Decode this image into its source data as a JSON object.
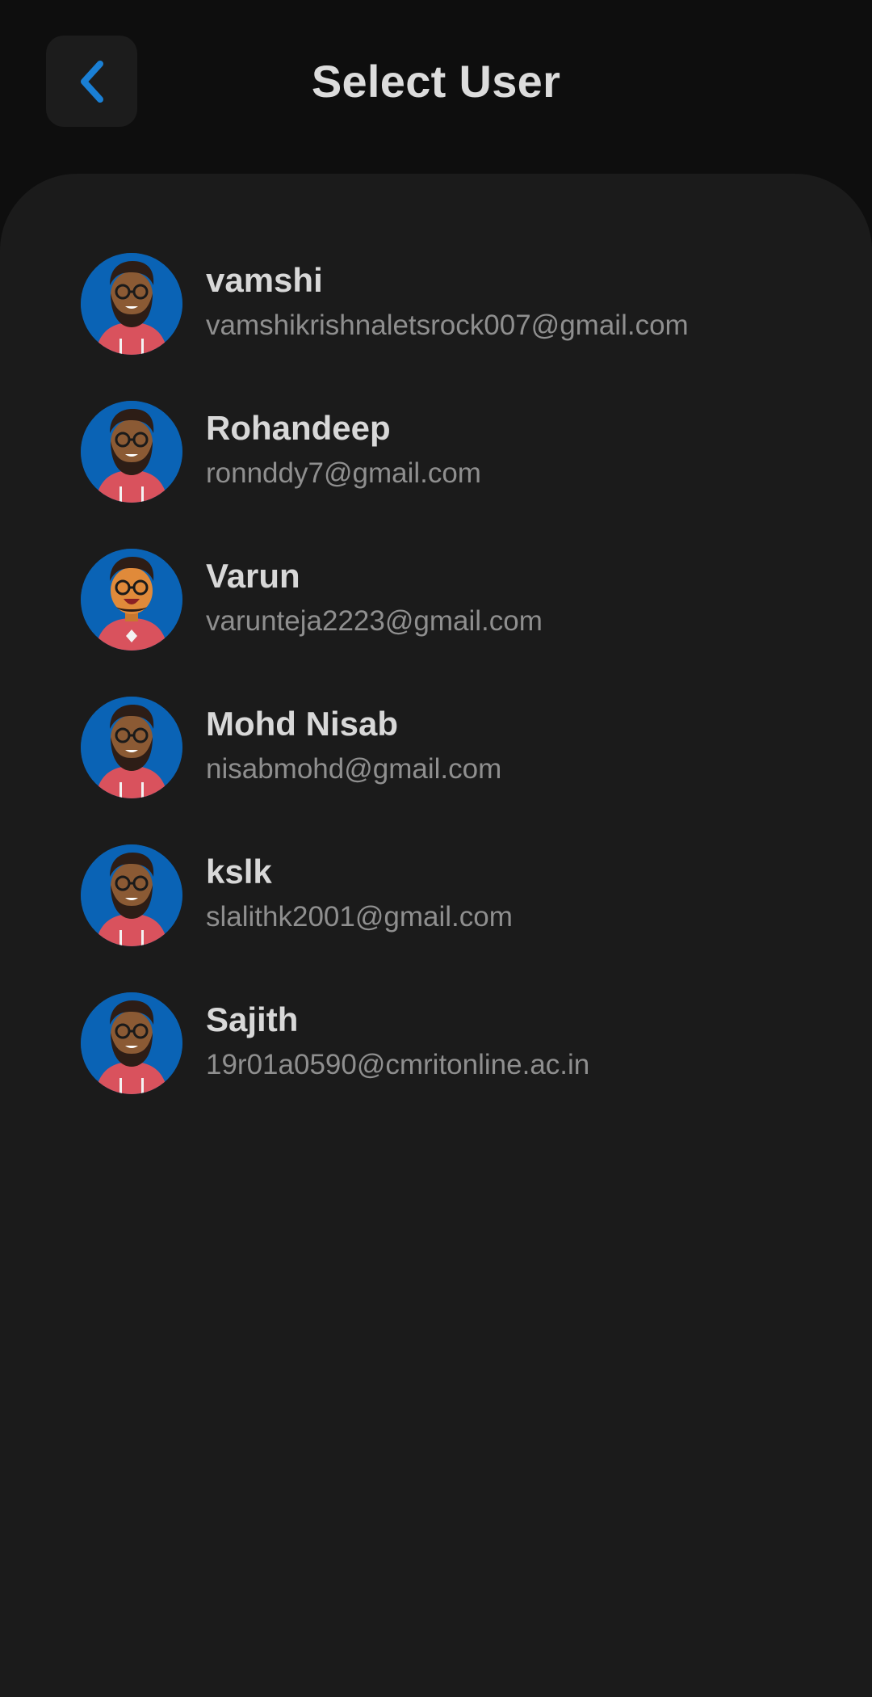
{
  "header": {
    "title": "Select User",
    "back_icon": "chevron-left-icon",
    "accent_color": "#1a7fd4"
  },
  "users": [
    {
      "name": "vamshi",
      "email": "vamshikrishnaletsrock007@gmail.com",
      "avatar": "bearded-man-avatar"
    },
    {
      "name": "Rohandeep",
      "email": "ronnddy7@gmail.com",
      "avatar": "bearded-man-avatar"
    },
    {
      "name": "Varun",
      "email": "varunteja2223@gmail.com",
      "avatar": "smiling-man-avatar"
    },
    {
      "name": "Mohd Nisab",
      "email": "nisabmohd@gmail.com",
      "avatar": "bearded-man-avatar"
    },
    {
      "name": "kslk",
      "email": "slalithk2001@gmail.com",
      "avatar": "bearded-man-avatar"
    },
    {
      "name": "Sajith",
      "email": "19r01a0590@cmritonline.ac.in",
      "avatar": "bearded-man-avatar"
    }
  ]
}
